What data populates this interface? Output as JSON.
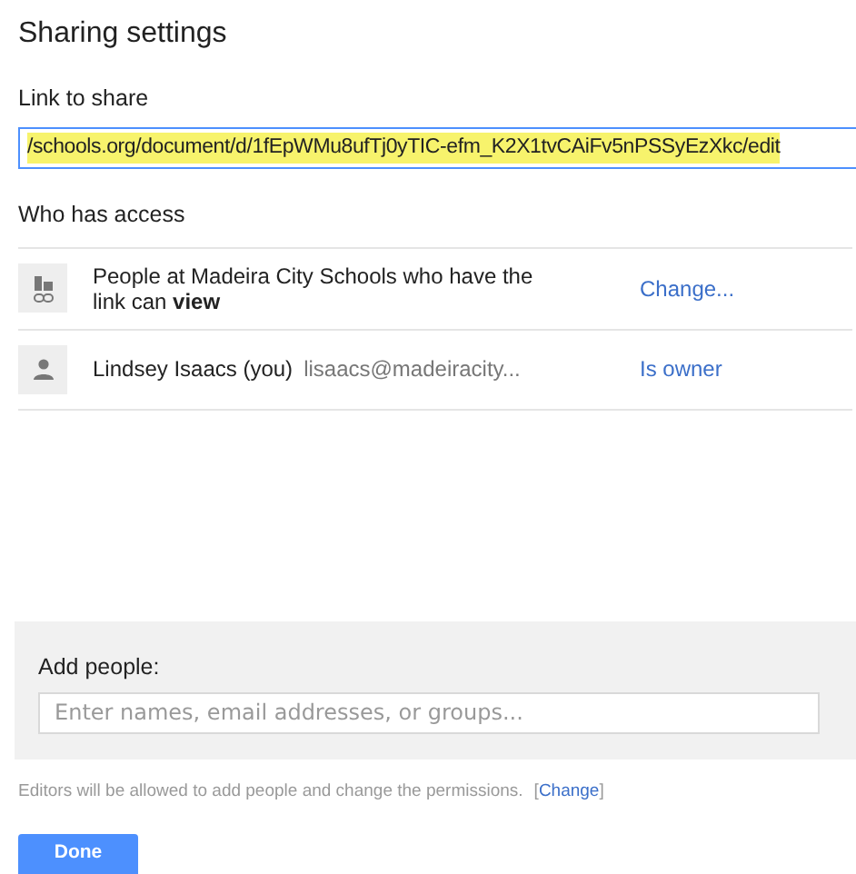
{
  "title": "Sharing settings",
  "link_section": {
    "label": "Link to share",
    "value": "/schools.org/document/d/1fEpWMu8ufTj0yTIC-efm_K2X1tvCAiFv5nPSSyEzXkc/edit",
    "selected": true
  },
  "access_section": {
    "label": "Who has access",
    "entries": [
      {
        "kind": "link",
        "text": "People at Madeira City Schools who have the link can **view**",
        "action": "Change..."
      },
      {
        "kind": "person",
        "name": "Lindsey Isaacs (you)",
        "email": "lisaacs@madeiracity...",
        "action": "Is owner"
      }
    ]
  },
  "add_people": {
    "label": "Add people:",
    "placeholder": "Enter names, email addresses, or groups..."
  },
  "notice": {
    "text": "Editors will be allowed to add people and change the permissions.",
    "open_bracket": "[",
    "link": "Change",
    "close_bracket": "]"
  },
  "buttons": [
    "Done"
  ]
}
